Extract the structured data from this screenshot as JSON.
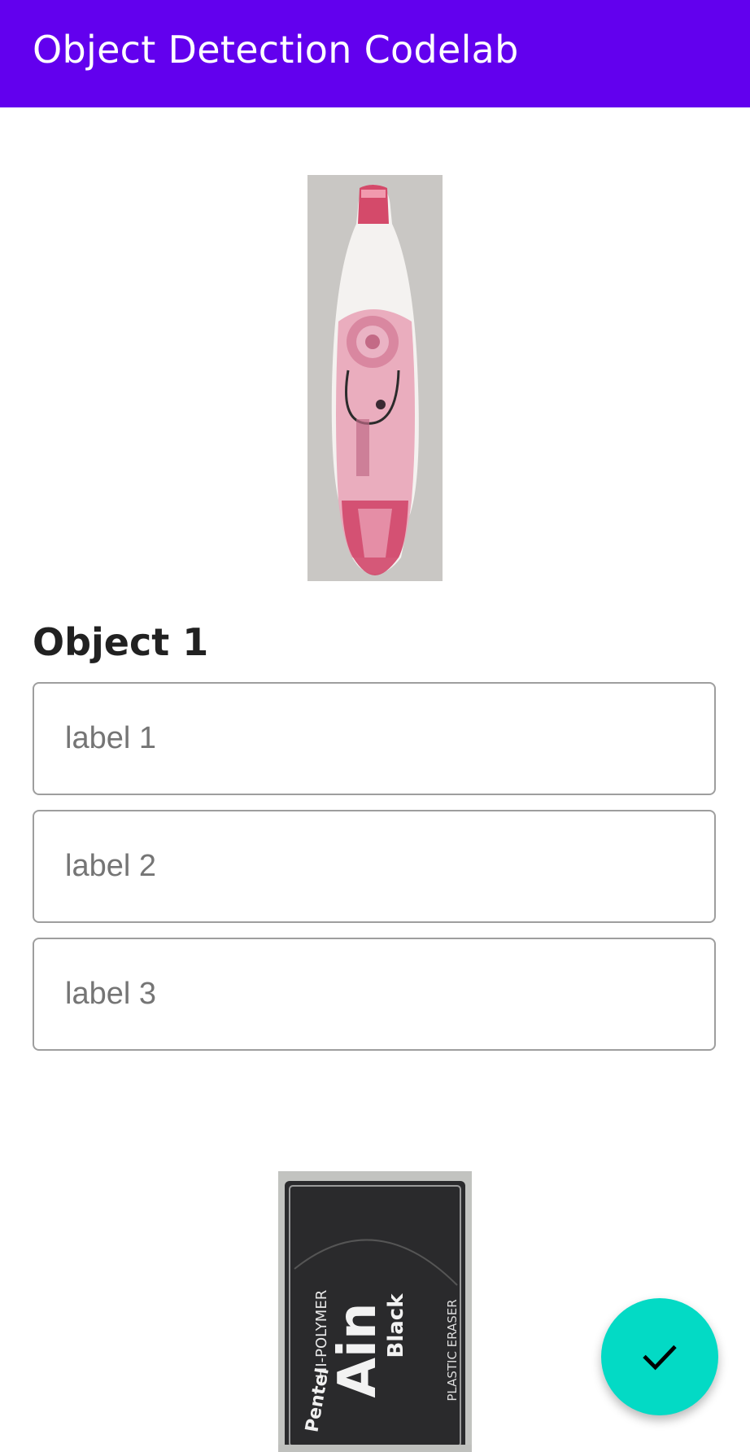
{
  "app_bar": {
    "title": "Object Detection Codelab",
    "color": "#6200ee"
  },
  "objects": [
    {
      "heading": "Object 1",
      "image": "correction-tape-image",
      "label_fields": [
        {
          "placeholder": "label 1",
          "value": ""
        },
        {
          "placeholder": "label 2",
          "value": ""
        },
        {
          "placeholder": "label 3",
          "value": ""
        }
      ]
    },
    {
      "image": "eraser-image",
      "image_text": [
        "Pentel",
        "Ain",
        "Black",
        "HI-POLYMER",
        "PLASTIC ERASER"
      ]
    }
  ],
  "fab": {
    "icon": "check-icon",
    "color": "#03dac5"
  }
}
